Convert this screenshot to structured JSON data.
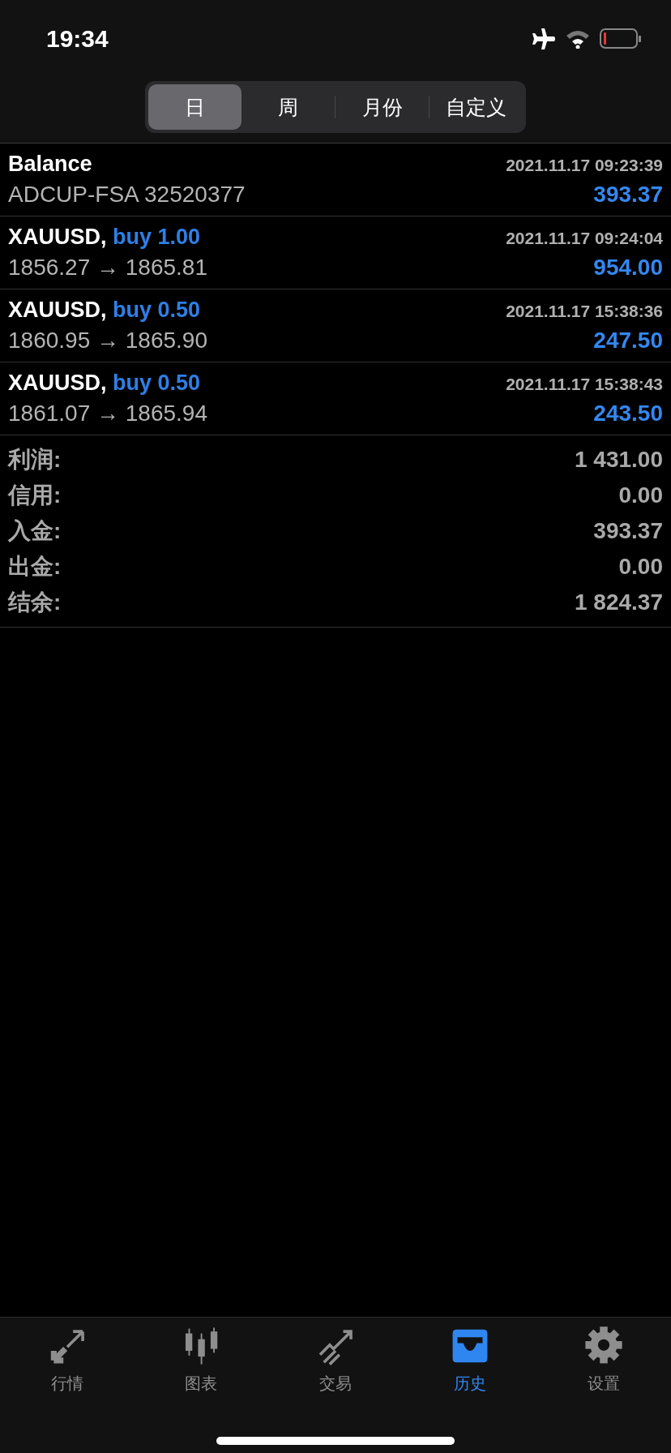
{
  "status_bar": {
    "time": "19:34"
  },
  "period_tabs": [
    {
      "label": "日",
      "selected": true
    },
    {
      "label": "周",
      "selected": false
    },
    {
      "label": "月份",
      "selected": false
    },
    {
      "label": "自定义",
      "selected": false
    }
  ],
  "deals": [
    {
      "kind": "balance",
      "title": "Balance",
      "time": "2021.11.17 09:23:39",
      "detail": "ADCUP-FSA 32520377",
      "amount": "393.37"
    },
    {
      "kind": "trade",
      "symbol": "XAUUSD,",
      "order": "buy 1.00",
      "time": "2021.11.17 09:24:04",
      "detail": "1856.27 → 1865.81",
      "amount": "954.00"
    },
    {
      "kind": "trade",
      "symbol": "XAUUSD,",
      "order": "buy 0.50",
      "time": "2021.11.17 15:38:36",
      "detail": "1860.95 → 1865.90",
      "amount": "247.50"
    },
    {
      "kind": "trade",
      "symbol": "XAUUSD,",
      "order": "buy 0.50",
      "time": "2021.11.17 15:38:43",
      "detail": "1861.07 → 1865.94",
      "amount": "243.50"
    }
  ],
  "summary": [
    {
      "label": "利润:",
      "value": "1 431.00"
    },
    {
      "label": "信用:",
      "value": "0.00"
    },
    {
      "label": "入金:",
      "value": "393.37"
    },
    {
      "label": "出金:",
      "value": "0.00"
    },
    {
      "label": "结余:",
      "value": "1 824.37"
    }
  ],
  "tab_bar": [
    {
      "label": "行情",
      "kind": "quotes",
      "selected": false
    },
    {
      "label": "图表",
      "kind": "chart",
      "selected": false
    },
    {
      "label": "交易",
      "kind": "trade",
      "selected": false
    },
    {
      "label": "历史",
      "kind": "history",
      "selected": true
    },
    {
      "label": "设置",
      "kind": "settings",
      "selected": false
    }
  ]
}
